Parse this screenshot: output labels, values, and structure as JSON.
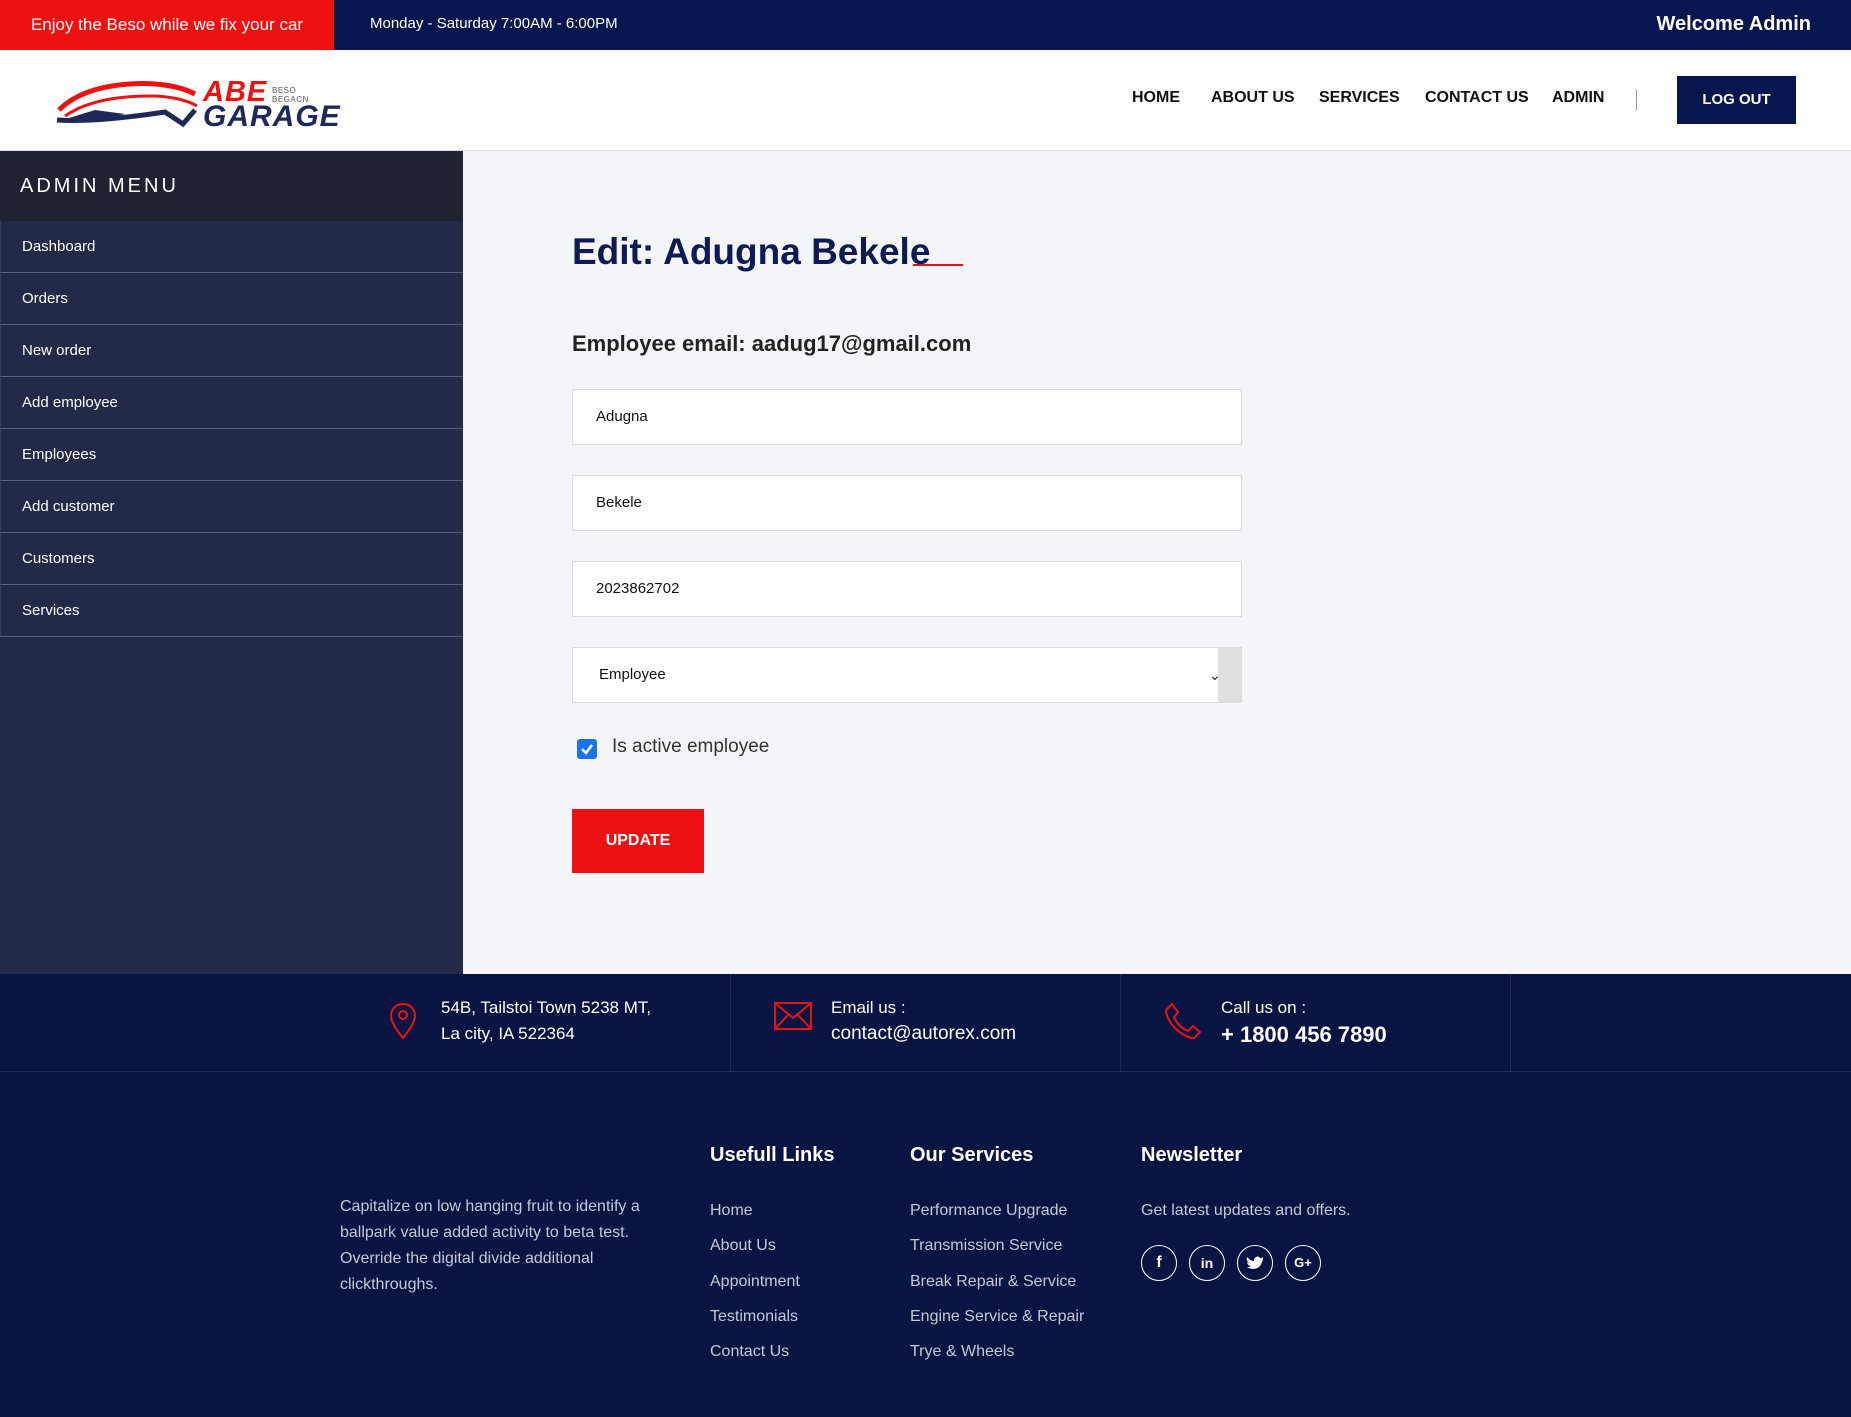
{
  "topbar": {
    "promo": "Enjoy the Beso while we fix your car",
    "hours": "Monday - Saturday 7:00AM - 6:00PM",
    "welcome": "Welcome Admin"
  },
  "logo": {
    "abe": "ABE",
    "tagline": "BESO BEGACN",
    "garage": "GARAGE"
  },
  "nav": {
    "items": [
      "HOME",
      "ABOUT US",
      "SERVICES",
      "CONTACT US",
      "ADMIN"
    ],
    "logout": "LOG OUT"
  },
  "sidebar": {
    "title": "ADMIN MENU",
    "items": [
      "Dashboard",
      "Orders",
      "New order",
      "Add employee",
      "Employees",
      "Add customer",
      "Customers",
      "Services"
    ]
  },
  "form": {
    "title": "Edit: Adugna Bekele",
    "email_line": "Employee email: aadug17@gmail.com",
    "first_name": "Adugna",
    "last_name": "Bekele",
    "phone": "2023862702",
    "role": "Employee",
    "active_label": "Is active employee",
    "active_checked": true,
    "update_label": "UPDATE"
  },
  "contact": {
    "address_line1": "54B, Tailstoi Town 5238 MT,",
    "address_line2": "La city, IA 522364",
    "email_label": "Email us :",
    "email_value": "contact@autorex.com",
    "phone_label": "Call us on :",
    "phone_value": "+ 1800 456 7890"
  },
  "footer": {
    "about": "Capitalize on low hanging fruit to identify a ballpark value added activity to beta test. Override the digital divide additional clickthroughs.",
    "links_title": "Usefull Links",
    "links": [
      "Home",
      "About Us",
      "Appointment",
      "Testimonials",
      "Contact Us"
    ],
    "services_title": "Our Services",
    "services": [
      "Performance Upgrade",
      "Transmission Service",
      "Break Repair & Service",
      "Engine Service & Repair",
      "Trye & Wheels"
    ],
    "newsletter_title": "Newsletter",
    "newsletter_text": "Get latest updates and offers.",
    "social": [
      "facebook-icon",
      "linkedin-icon",
      "twitter-icon",
      "google-plus-icon"
    ]
  },
  "colors": {
    "brand_red": "#ee1111",
    "brand_navy": "#081650",
    "sidebar_bg": "#232a48",
    "footer_bg": "#081542"
  }
}
